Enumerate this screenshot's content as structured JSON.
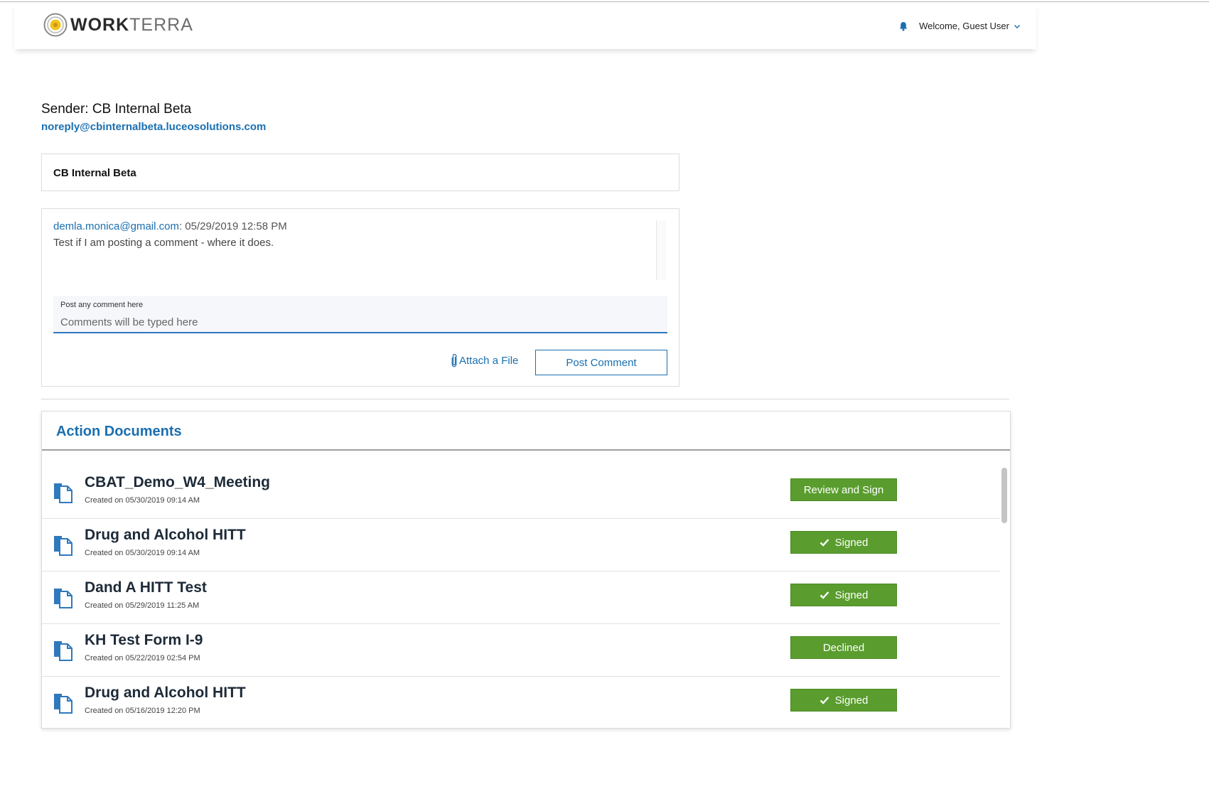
{
  "header": {
    "logo_bold": "WORK",
    "logo_light": "TERRA",
    "welcome": "Welcome, Guest User"
  },
  "sender": {
    "label": "Sender: CB Internal Beta",
    "email": "noreply@cbinternalbeta.luceosolutions.com"
  },
  "subject": "CB Internal Beta",
  "comments": {
    "items": [
      {
        "author": "demla.monica@gmail.com",
        "separator": ":",
        "timestamp": "05/29/2019 12:58 PM",
        "text": "Test if I am posting a comment - where it does."
      }
    ],
    "input_label": "Post any comment here",
    "input_placeholder": "Comments will be typed here",
    "attach_label": "Attach a File",
    "post_label": "Post Comment"
  },
  "documents": {
    "title": "Action Documents",
    "items": [
      {
        "name": "CBAT_Demo_W4_Meeting",
        "created": "Created on 05/30/2019 09:14 AM",
        "action": "Review and Sign",
        "checked": false
      },
      {
        "name": "Drug and Alcohol HITT",
        "created": "Created on 05/30/2019 09:14 AM",
        "action": "Signed",
        "checked": true
      },
      {
        "name": "Dand A HITT Test",
        "created": "Created on 05/29/2019 11:25 AM",
        "action": "Signed",
        "checked": true
      },
      {
        "name": "KH Test Form I-9",
        "created": "Created on 05/22/2019 02:54 PM",
        "action": "Declined",
        "checked": false
      },
      {
        "name": "Drug and Alcohol HITT",
        "created": "Created on 05/16/2019 12:20 PM",
        "action": "Signed",
        "checked": true
      }
    ]
  },
  "colors": {
    "accent": "#1a6fb0",
    "action_green": "#5a9d2e"
  }
}
